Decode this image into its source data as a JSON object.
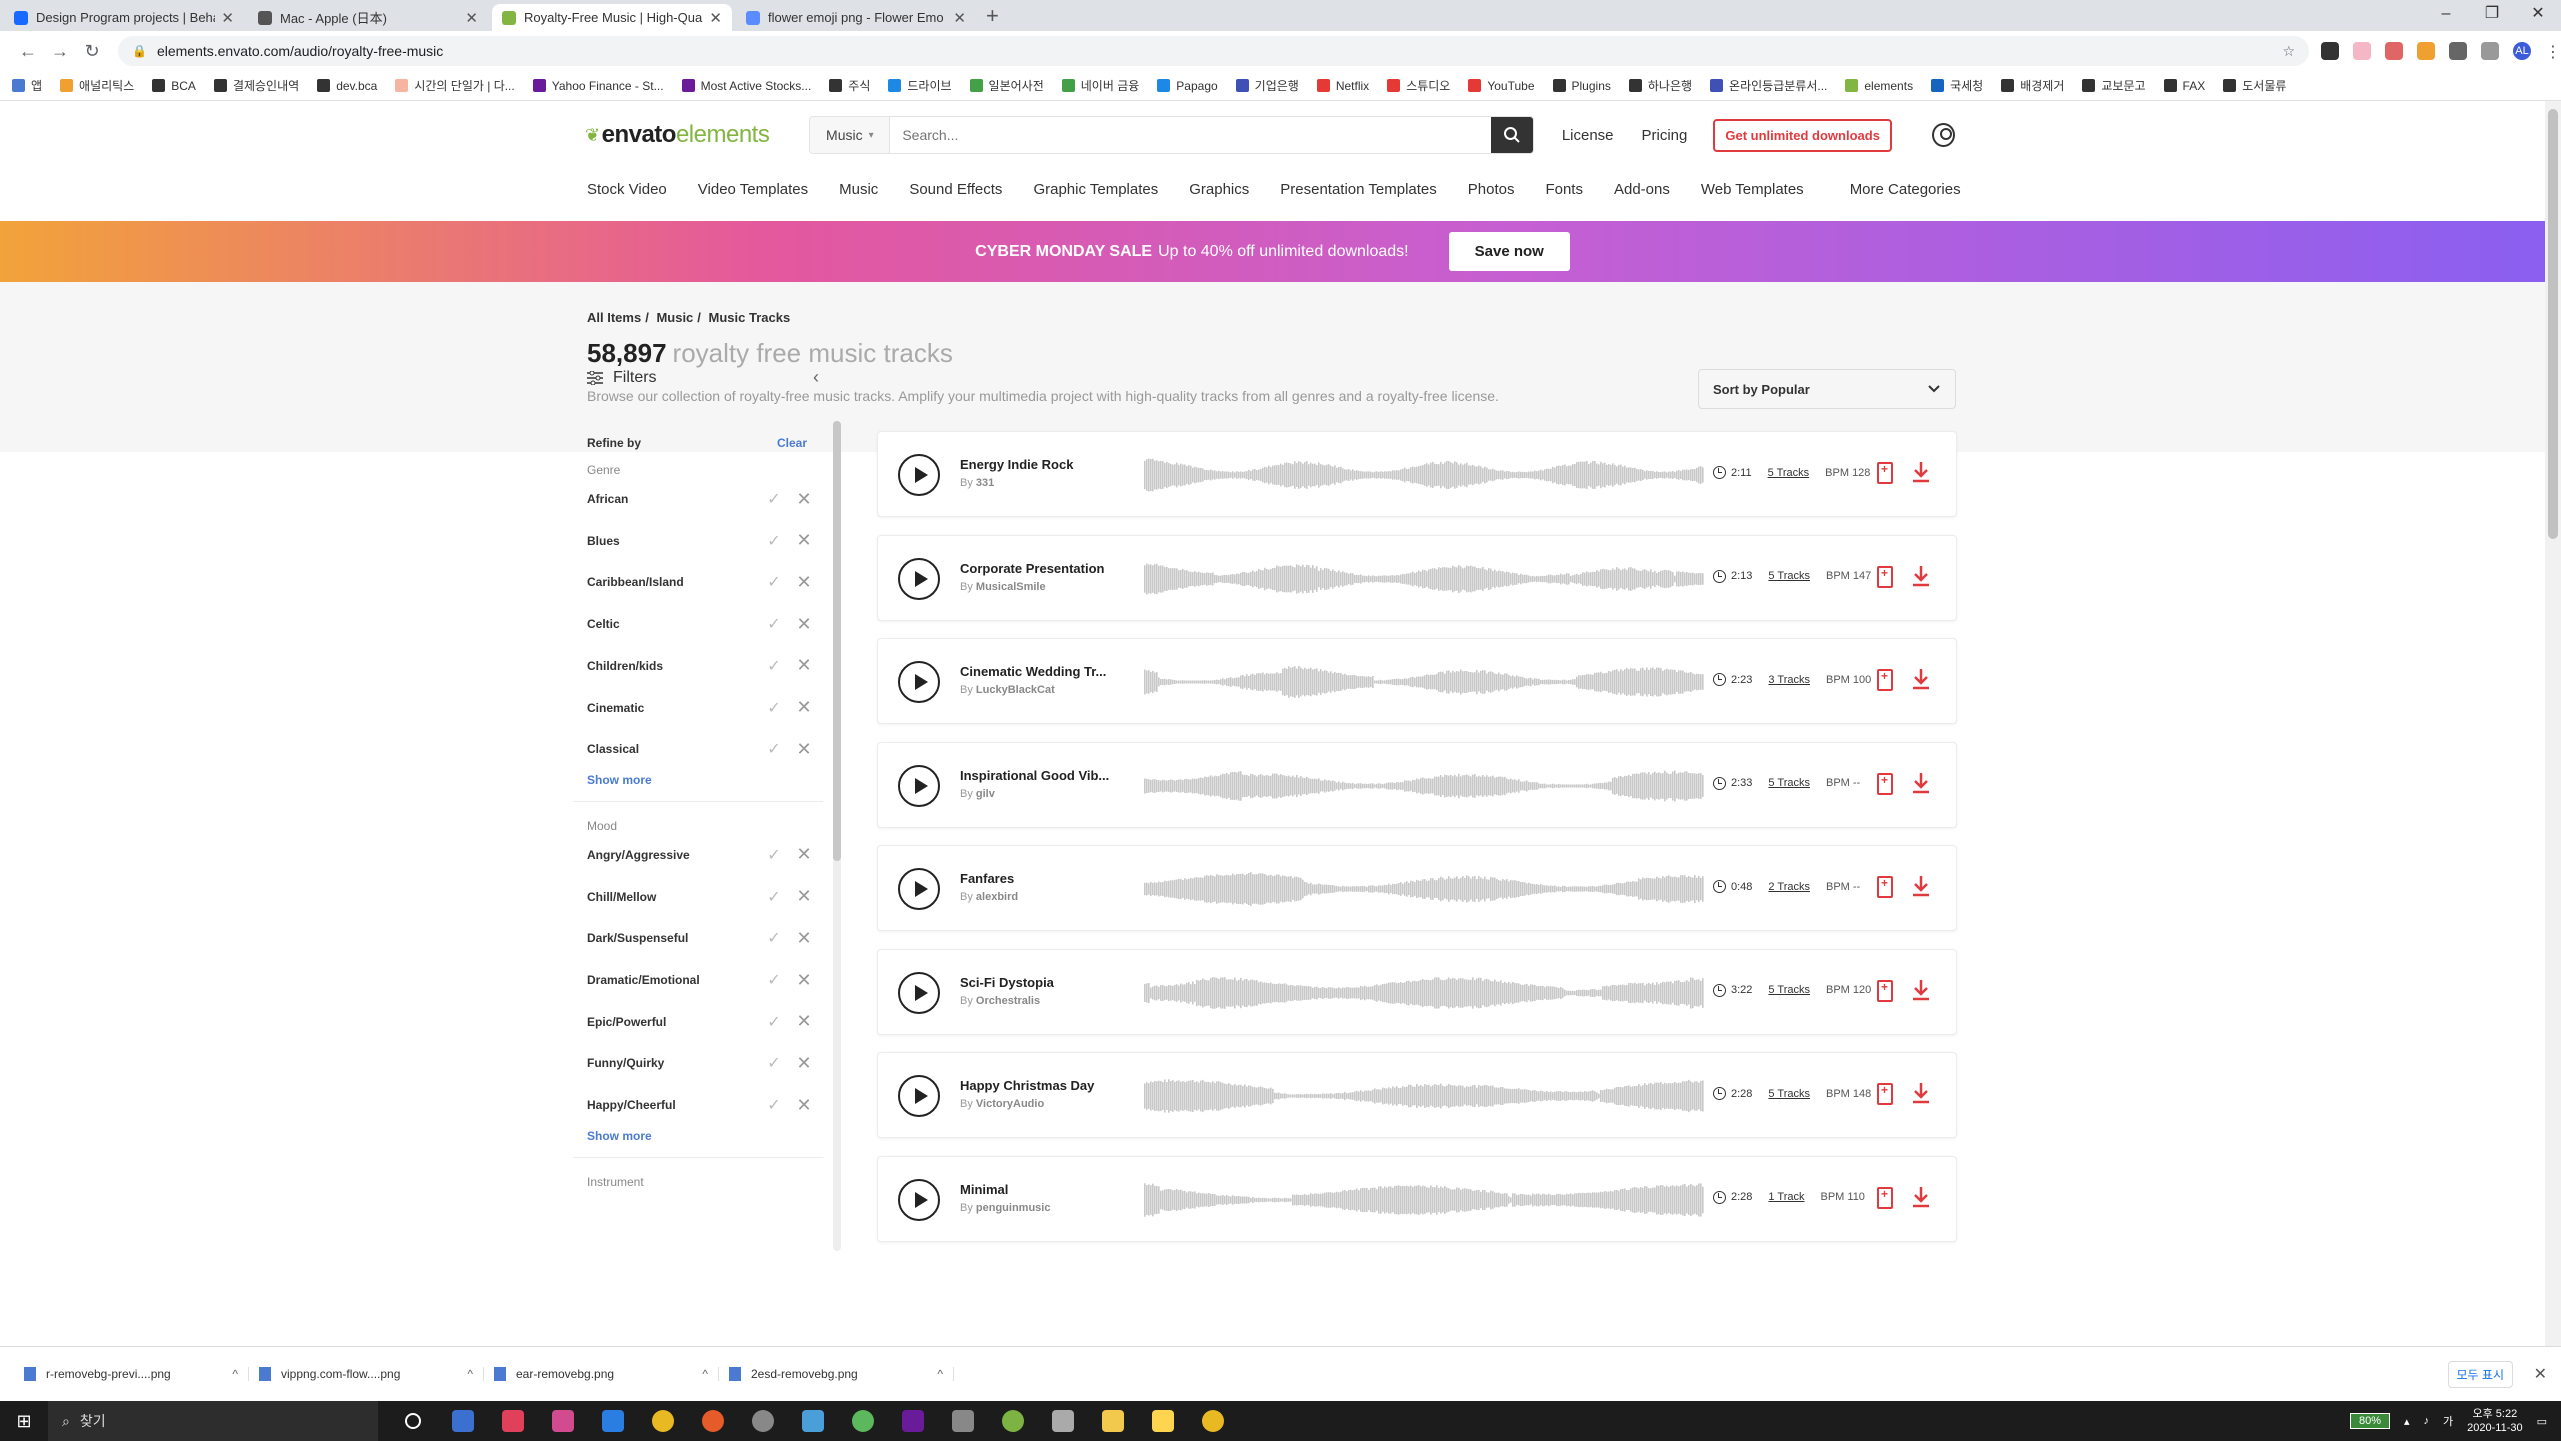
{
  "browser": {
    "tabs": [
      {
        "title": "Design Program projects | Beha",
        "color": "#1769ff"
      },
      {
        "title": "Mac - Apple (日本)",
        "color": "#555555"
      },
      {
        "title": "Royalty-Free Music | High-Qua",
        "color": "#82b541"
      },
      {
        "title": "flower emoji png - Flower Emo",
        "color": "#5b8cff"
      }
    ],
    "active_tab": 2,
    "url": "elements.envato.com/audio/royalty-free-music",
    "bookmarks": [
      "앱",
      "애널리틱스",
      "BCA",
      "결제승인내역",
      "dev.bca",
      "시간의 단일가 | 다...",
      "Yahoo Finance - St...",
      "Most Active Stocks...",
      "주식",
      "드라이브",
      "일본어사전",
      "네이버 금융",
      "Papago",
      "기업은행",
      "Netflix",
      "스튜디오",
      "YouTube",
      "Plugins",
      "하나은행",
      "온라인등급분류서...",
      "elements",
      "국세청",
      "배경제거",
      "교보문고",
      "FAX",
      "도서물류"
    ]
  },
  "header": {
    "logo_main": "envato",
    "logo_accent": "elements",
    "search_category": "Music",
    "search_placeholder": "Search...",
    "license": "License",
    "pricing": "Pricing",
    "cta": "Get unlimited downloads"
  },
  "categories": [
    "Stock Video",
    "Video Templates",
    "Music",
    "Sound Effects",
    "Graphic Templates",
    "Graphics",
    "Presentation Templates",
    "Photos",
    "Fonts",
    "Add-ons",
    "Web Templates"
  ],
  "more_categories": "More Categories",
  "banner": {
    "bold": "CYBER MONDAY SALE",
    "text": "Up to 40% off unlimited downloads!",
    "button": "Save now"
  },
  "hero": {
    "crumb_1": "All Items",
    "crumb_2": "Music",
    "crumb_3": "Music Tracks",
    "count": "58,897",
    "title": "royalty free music tracks",
    "description": "Browse our collection of royalty-free music tracks. Amplify your multimedia project with high-quality tracks from all genres and a royalty-free license."
  },
  "filters": {
    "title": "Filters",
    "refine": "Refine by",
    "clear": "Clear",
    "genre_label": "Genre",
    "genres": [
      "African",
      "Blues",
      "Caribbean/Island",
      "Celtic",
      "Children/kids",
      "Cinematic",
      "Classical"
    ],
    "show_more": "Show more",
    "mood_label": "Mood",
    "moods": [
      "Angry/Aggressive",
      "Chill/Mellow",
      "Dark/Suspenseful",
      "Dramatic/Emotional",
      "Epic/Powerful",
      "Funny/Quirky",
      "Happy/Cheerful"
    ],
    "instrument_label": "Instrument"
  },
  "sort": "Sort by Popular",
  "tracks": [
    {
      "title": "Energy Indie Rock",
      "author": "331",
      "duration": "2:11",
      "tracks": "5 Tracks",
      "bpm": "BPM 128"
    },
    {
      "title": "Corporate Presentation",
      "author": "MusicalSmile",
      "duration": "2:13",
      "tracks": "5 Tracks",
      "bpm": "BPM 147"
    },
    {
      "title": "Cinematic Wedding Tr...",
      "author": "LuckyBlackCat",
      "duration": "2:23",
      "tracks": "3 Tracks",
      "bpm": "BPM 100"
    },
    {
      "title": "Inspirational Good Vib...",
      "author": "gilv",
      "duration": "2:33",
      "tracks": "5 Tracks",
      "bpm": "BPM --"
    },
    {
      "title": "Fanfares",
      "author": "alexbird",
      "duration": "0:48",
      "tracks": "2 Tracks",
      "bpm": "BPM --"
    },
    {
      "title": "Sci-Fi Dystopia",
      "author": "Orchestralis",
      "duration": "3:22",
      "tracks": "5 Tracks",
      "bpm": "BPM 120"
    },
    {
      "title": "Happy Christmas Day",
      "author": "VictoryAudio",
      "duration": "2:28",
      "tracks": "5 Tracks",
      "bpm": "BPM 148"
    },
    {
      "title": "Minimal",
      "author": "penguinmusic",
      "duration": "2:28",
      "tracks": "1 Track",
      "bpm": "BPM 110"
    }
  ],
  "by_prefix": "By",
  "downloads": [
    "r-removebg-previ....png",
    "vippng.com-flow....png",
    "ear-removebg.png",
    "2esd-removebg.png"
  ],
  "show_all": "모두 표시",
  "taskbar": {
    "search": "찾기",
    "battery": "80%",
    "time": "오후 5:22",
    "date": "2020-11-30"
  },
  "colors": {
    "accent": "#82b541",
    "cta": "#e03a3e",
    "link": "#4a7bd0"
  }
}
